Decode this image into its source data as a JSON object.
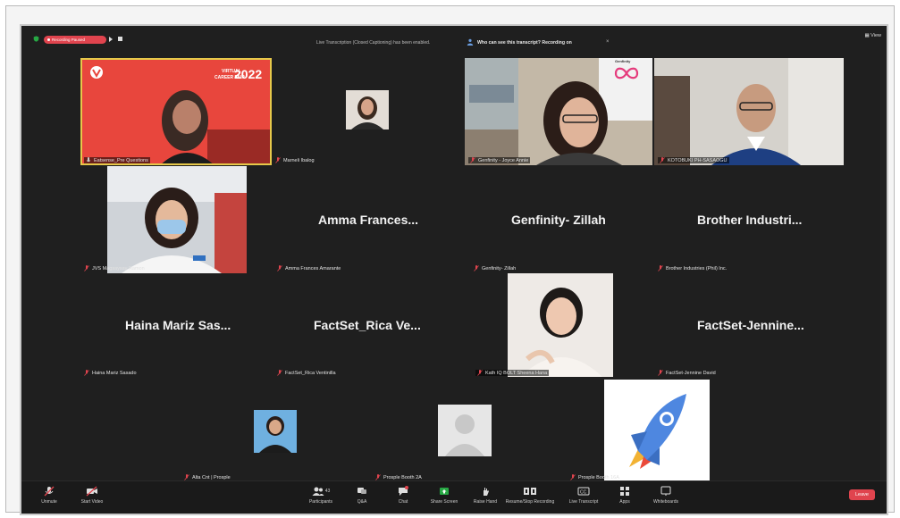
{
  "topbar": {
    "recording_status": "Recording Paused",
    "caption_notice": "Live Transcription (Closed Captioning) has been enabled.",
    "caption_link": "Who can see this transcript? Recording on",
    "view_label": "View"
  },
  "participants": [
    {
      "name": "Eatsense_Pre Questions",
      "type": "video",
      "speaking": true
    },
    {
      "name": "Marneli Ibalog",
      "type": "thumb"
    },
    {
      "name": "Genfinity - Joyce Annie",
      "type": "video"
    },
    {
      "name": "KOTOBUKI PH-SASAOGU",
      "type": "video"
    },
    {
      "name": "JVS Magsaysay Ramon",
      "type": "video"
    },
    {
      "name": "Amma Frances Amarante",
      "display": "Amma  Frances...",
      "type": "name"
    },
    {
      "name": "Genfinity- Zillah",
      "display": "Genfinity- Zillah",
      "type": "name"
    },
    {
      "name": "Brother Industries (Phil) Inc.",
      "display": "Brother  Industri...",
      "type": "name"
    },
    {
      "name": "Haina Mariz Sasado",
      "display": "Haina Mariz Sas...",
      "type": "name"
    },
    {
      "name": "FactSet_Rica Ventinilla",
      "display": "FactSet_Rica  Ve...",
      "type": "name"
    },
    {
      "name": "Kath IQ BOLT Sheena Hana",
      "type": "video"
    },
    {
      "name": "FactSet-Jennine David",
      "display": "FactSet-Jennine...",
      "type": "name"
    },
    {
      "name": "Alta Cnt | Prosple",
      "type": "thumb"
    },
    {
      "name": "Prosple Booth 2A",
      "type": "avatar"
    },
    {
      "name": "Prosple Booth 16A",
      "type": "logo"
    }
  ],
  "banner_text": {
    "line1": "VIRTUAL",
    "line2": "CAREER FAIR",
    "year": "2022"
  },
  "logo_text": "Genfinity",
  "toolbar": {
    "items": [
      {
        "label": "Unmute",
        "icon": "mic-muted-icon"
      },
      {
        "label": "Start Video",
        "icon": "video-off-icon"
      },
      {
        "label": "Participants",
        "icon": "participants-icon",
        "count": "43"
      },
      {
        "label": "Q&A",
        "icon": "qa-icon"
      },
      {
        "label": "Chat",
        "icon": "chat-icon"
      },
      {
        "label": "Share Screen",
        "icon": "share-screen-icon"
      },
      {
        "label": "Raise Hand",
        "icon": "raise-hand-icon"
      },
      {
        "label": "Resume/Stop Recording",
        "icon": "record-icon"
      },
      {
        "label": "Live Transcript",
        "icon": "cc-icon"
      },
      {
        "label": "Apps",
        "icon": "apps-icon"
      },
      {
        "label": "Whiteboards",
        "icon": "whiteboard-icon"
      }
    ],
    "leave_label": "Leave"
  },
  "colors": {
    "accent": "#e0444e",
    "background": "#1f1f1f",
    "speaking_border": "#e6c84a"
  }
}
